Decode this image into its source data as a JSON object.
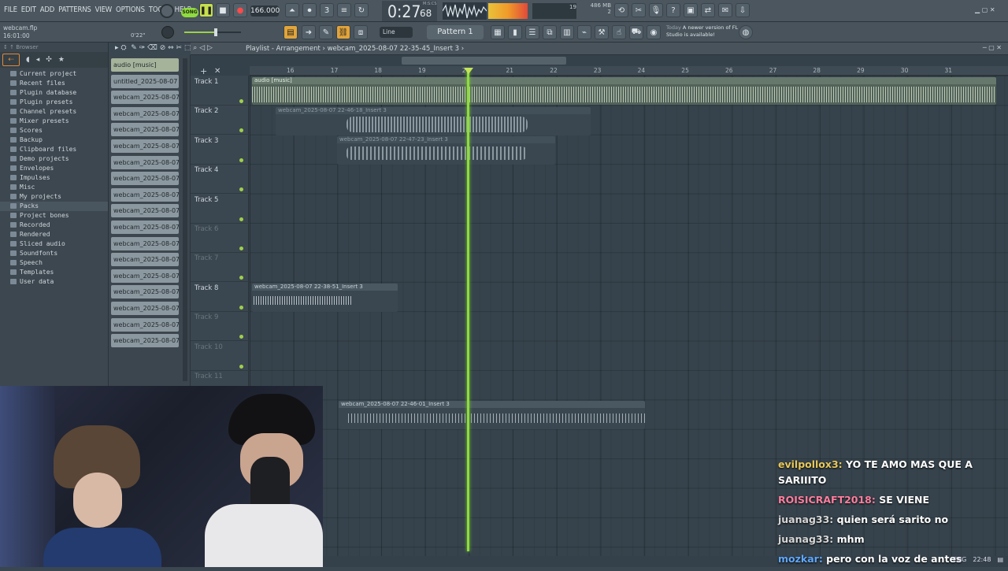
{
  "menu": {
    "items": [
      "FILE",
      "EDIT",
      "ADD",
      "PATTERNS",
      "VIEW",
      "OPTIONS",
      "TOOLS",
      "HELP"
    ]
  },
  "transport": {
    "mode": "SONG",
    "tempo": "166.000",
    "time_main": "0:27",
    "time_sub": "68",
    "time_label": "M:S:CS",
    "cpu": "19",
    "mem": "486 MB",
    "mem_sub": "2"
  },
  "project": {
    "file": "webcam.flp",
    "timestamp": "16:01:00",
    "pos": "0'22\""
  },
  "toolbar2": {
    "snap": "Line",
    "pattern": "Pattern 1",
    "news_title": "Today",
    "news_text": "A newer version of FL Studio is available!"
  },
  "browser": {
    "title": "Browser",
    "items": [
      "Current project",
      "Recent files",
      "Plugin database",
      "Plugin presets",
      "Channel presets",
      "Mixer presets",
      "Scores",
      "Backup",
      "Clipboard files",
      "Demo projects",
      "Envelopes",
      "Impulses",
      "Misc",
      "My projects",
      "Packs",
      "Project bones",
      "Recorded",
      "Rendered",
      "Sliced audio",
      "Soundfonts",
      "Speech",
      "Templates",
      "User data"
    ]
  },
  "playlist": {
    "title": "Playlist - Arrangement",
    "clip_name": "webcam_2025-08-07 22-35-45_Insert 3"
  },
  "channels": [
    "audio [music]",
    "untitled_2025-08-07 18-...",
    "webcam_2025-08-07 18...",
    "webcam_2025-08-07 18...",
    "webcam_2025-08-07 18...",
    "webcam_2025-08-07 18...",
    "webcam_2025-08-07 18...",
    "webcam_2025-08-07 18...",
    "webcam_2025-08-07 18...",
    "webcam_2025-08-07 18...",
    "webcam_2025-08-07 18...",
    "webcam_2025-08-07 18...",
    "webcam_2025-08-07 18...",
    "webcam_2025-08-07 18...",
    "webcam_2025-08-07 19...",
    "webcam_2025-08-07 19...",
    "webcam_2025-08-07 19...",
    "webcam_2025-08-07 19..."
  ],
  "tracks": [
    "Track 1",
    "Track 2",
    "Track 3",
    "Track 4",
    "Track 5",
    "Track 6",
    "Track 7",
    "Track 8",
    "Track 9",
    "Track 10",
    "Track 11"
  ],
  "ruler": [
    "16",
    "17",
    "18",
    "19",
    "20",
    "21",
    "22",
    "23",
    "24",
    "25",
    "26",
    "27",
    "28",
    "29",
    "30",
    "31"
  ],
  "clips": {
    "c1": "audio [music]",
    "c2": "webcam_2025-08-07 22-46-18_Insert 3",
    "c3": "webcam_2025-08-07 22-47-23_Insert 3",
    "c4": "webcam_2025-08-07 22-38-51_Insert 3",
    "c5": "webcam_2025-08-07 22-46-01_Insert 3"
  },
  "chat": [
    {
      "user": "evilpollox3",
      "color": "#e8c95a",
      "text": "YO TE AMO MAS QUE A SARIIITO"
    },
    {
      "user": "ROISICRAFT2018",
      "color": "#ff7f9f",
      "text": "SE VIENE"
    },
    {
      "user": "juanag33",
      "color": "#d7d7d7",
      "text": "quien será sarito no"
    },
    {
      "user": "juanag33",
      "color": "#d7d7d7",
      "text": "mhm"
    },
    {
      "user": "mozkar",
      "color": "#5fa8ff",
      "text": "pero con la voz de antes"
    }
  ],
  "taskbar": {
    "lang": "ENG",
    "clock": "22:48"
  },
  "colors": {
    "accent": "#8fdc3e",
    "audio_clip": "#b8c8b0",
    "webcam_clip": "#4c5861"
  }
}
